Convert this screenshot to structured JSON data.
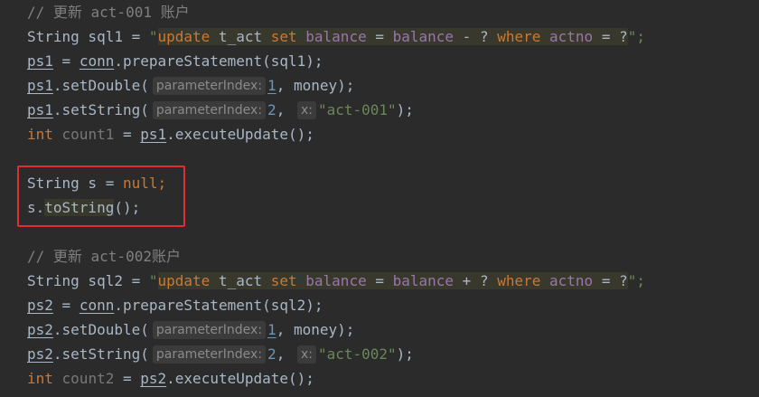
{
  "lines": {
    "c1": "// 更新 act-001 账户",
    "l2_a": "String sql1 = ",
    "l2_q1": "\"",
    "l2_update": "update",
    "l2_tact": " t_act ",
    "l2_set": "set",
    "l2_bal1": " balance",
    "l2_eq1": " = ",
    "l2_bal2": "balance",
    "l2_op": " - ? ",
    "l2_where": "where",
    "l2_actno": " actno",
    "l2_eq2": " = ?",
    "l2_q2": "\";",
    "l3_ps": "ps1",
    "l3_mid": " = ",
    "l3_conn": "conn",
    "l3_rest": ".prepareStatement(sql1);",
    "l4_ps": "ps1",
    "l4_a": ".setDouble(",
    "l4_hint": "parameterIndex:",
    "l4_num": "1",
    "l4_b": ", money);",
    "l5_ps": "ps1",
    "l5_a": ".setString(",
    "l5_hint": "parameterIndex:",
    "l5_num": "2",
    "l5_comma": ", ",
    "l5_hint2": "x:",
    "l5_str": "\"act-001\"",
    "l5_b": ");",
    "l6_kw": "int",
    "l6_var": " count1",
    "l6_mid": " = ",
    "l6_ps": "ps1",
    "l6_rest": ".executeUpdate();",
    "l8_a": "String s = ",
    "l8_null": "null",
    "l8_b": ";",
    "l9_a": "s.",
    "l9_m": "toString",
    "l9_b": "();",
    "c2": "// 更新 act-002账户",
    "l12_a": "String sql2 = ",
    "l12_q1": "\"",
    "l12_update": "update",
    "l12_tact": " t_act ",
    "l12_set": "set",
    "l12_bal1": " balance",
    "l12_eq1": " = ",
    "l12_bal2": "balance",
    "l12_op": " + ? ",
    "l12_where": "where",
    "l12_actno": " actno",
    "l12_eq2": " = ?",
    "l12_q2": "\";",
    "l13_ps": "ps2",
    "l13_mid": " = ",
    "l13_conn": "conn",
    "l13_rest": ".prepareStatement(sql2);",
    "l14_ps": "ps2",
    "l14_a": ".setDouble(",
    "l14_hint": "parameterIndex:",
    "l14_num": "1",
    "l14_b": ", money);",
    "l15_ps": "ps2",
    "l15_a": ".setString(",
    "l15_hint": "parameterIndex:",
    "l15_num": "2",
    "l15_comma": ", ",
    "l15_hint2": "x:",
    "l15_str": "\"act-002\"",
    "l15_b": ");",
    "l16_kw": "int",
    "l16_var": " count2",
    "l16_mid": " = ",
    "l16_ps": "ps2",
    "l16_rest": ".executeUpdate();"
  },
  "colors": {
    "background": "#2b2b2b",
    "keyword": "#cc7832",
    "string": "#6a8759",
    "number": "#6897bb",
    "comment": "#808080",
    "text": "#a9b7c6",
    "highlight_box": "#e02d2d"
  }
}
